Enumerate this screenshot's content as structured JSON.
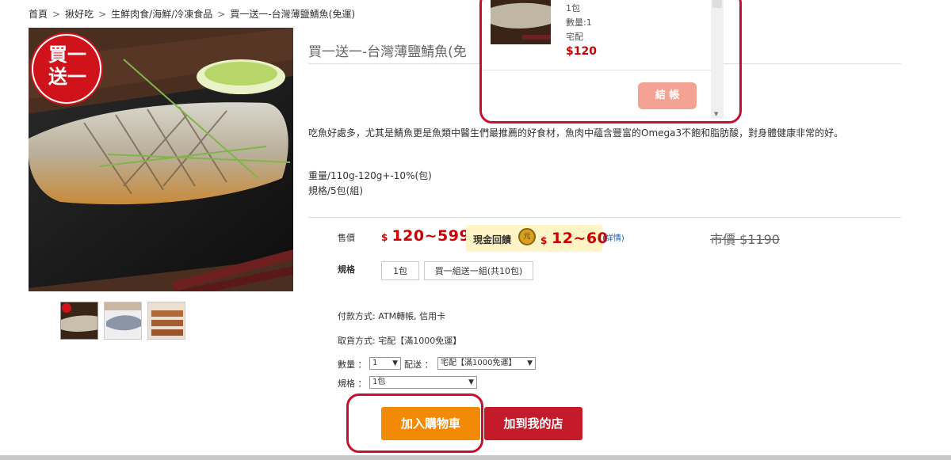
{
  "breadcrumb": {
    "items": [
      "首頁",
      "揪好吃",
      "生鮮肉食/海鮮/冷凍食品",
      "買一送一-台灣薄鹽鯖魚(免運)"
    ],
    "separator": ">"
  },
  "product": {
    "title": "買一送一-台灣薄鹽鯖魚(免",
    "badge_line1": "買一",
    "badge_line2": "送一",
    "description": "吃魚好處多，尤其是鯖魚更是魚類中醫生們最推薦的好食材，魚肉中蘊含豐富的Omega3不飽和脂肪酸，對身體健康非常的好。",
    "weight": "重量/110g-120g+-10%(包)",
    "spec_text": "規格/5包(組)"
  },
  "pricing": {
    "sale_label": "售價",
    "currency": "$",
    "sale_price": "120~599",
    "rebate_label": "現金回饋",
    "rebate_price": "12~60",
    "detail_link": "(詳情)",
    "market_price": "市價 $1190",
    "coin_glyph": "元"
  },
  "spec_options": {
    "label": "規格",
    "options": [
      "1包",
      "買一組送一組(共10包)"
    ]
  },
  "payment": "付款方式: ATM轉帳, 信用卡",
  "pickup": "取貨方式: 宅配【滿1000免運】",
  "quantity": {
    "label": "數量 ：",
    "value": "1"
  },
  "shipping": {
    "label": "配送 ：",
    "value": "宅配【滿1000免運】"
  },
  "spec_select": {
    "label": "規格 ：",
    "value": "1包"
  },
  "buttons": {
    "add_cart": "加入購物車",
    "add_store": "加到我的店"
  },
  "cart_popup": {
    "item_spec": "1包",
    "item_qty": "數量:1",
    "item_ship": "宅配",
    "item_price": "$120",
    "checkout": "結 帳"
  },
  "colors": {
    "price_red": "#cc0000",
    "cart_orange": "#f28a05",
    "store_red": "#c41a2a",
    "highlight_ring": "#c8102e",
    "checkout_pink": "#f4a294"
  }
}
